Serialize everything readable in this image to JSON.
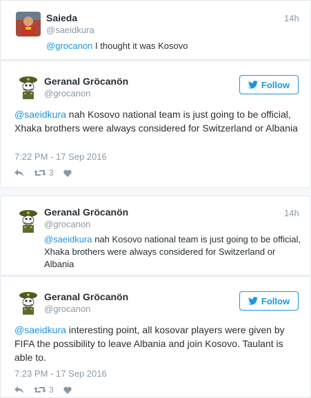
{
  "tweet1": {
    "name": "Saieda",
    "handle": "@saeidkura",
    "time": "14h",
    "mention": "@grocanon",
    "text": " I thought it was Kosovo"
  },
  "tweet2": {
    "name": "Geranal Gröcanön",
    "handle": "@grocanon",
    "follow_label": "Follow",
    "mention": "@saeidkura",
    "text": " nah Kosovo national team is just going to be official, Xhaka brothers were always considered for Switzerland or Albania",
    "date": "7:22 PM - 17 Sep 2016",
    "retweets": "3"
  },
  "tweet3": {
    "name": "Geranal Gröcanön",
    "handle": "@grocanon",
    "time": "14h",
    "mention": "@saeidkura",
    "text": " nah Kosovo national team is just going to be official, Xhaka brothers were always considered for Switzerland or Albania"
  },
  "tweet4": {
    "name": "Geranal Gröcanön",
    "handle": "@grocanon",
    "follow_label": "Follow",
    "mention": "@saeidkura",
    "text": " interesting point, all kosovar players were given by FIFA the possibility to leave Albania and join Kosovo. Taulant is able to.",
    "date": "7:23 PM - 17 Sep 2016",
    "retweets": "3"
  },
  "colors": {
    "link": "#1b95e0",
    "muted": "#8899a6",
    "text": "#292f33"
  },
  "icons": [
    "reply-icon",
    "retweet-icon",
    "like-icon",
    "twitter-bird-icon"
  ]
}
